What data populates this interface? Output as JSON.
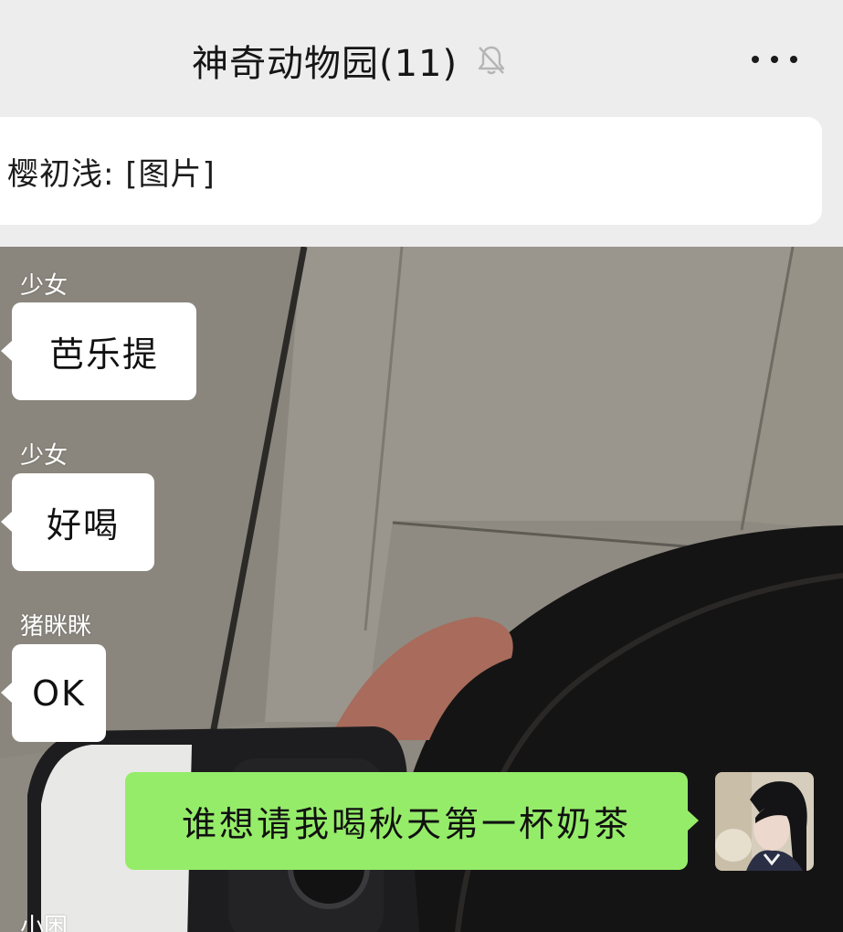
{
  "header": {
    "title": "神奇动物园(11)",
    "mute_icon": "bell-off-icon",
    "more_icon": "more-dots-icon"
  },
  "notice": {
    "text": "樱初浅: [图片]"
  },
  "messages": [
    {
      "sender": "少女",
      "text": "芭乐提",
      "side": "left"
    },
    {
      "sender": "少女",
      "text": "好喝",
      "side": "left"
    },
    {
      "sender": "猪眯眯",
      "text": "OK",
      "side": "left"
    },
    {
      "text": "谁想请我喝秋天第一杯奶茶",
      "side": "right"
    },
    {
      "sender": "小困",
      "side": "left"
    }
  ],
  "colors": {
    "background": "#ededed",
    "self_bubble": "#95ec69",
    "other_bubble": "#ffffff"
  }
}
